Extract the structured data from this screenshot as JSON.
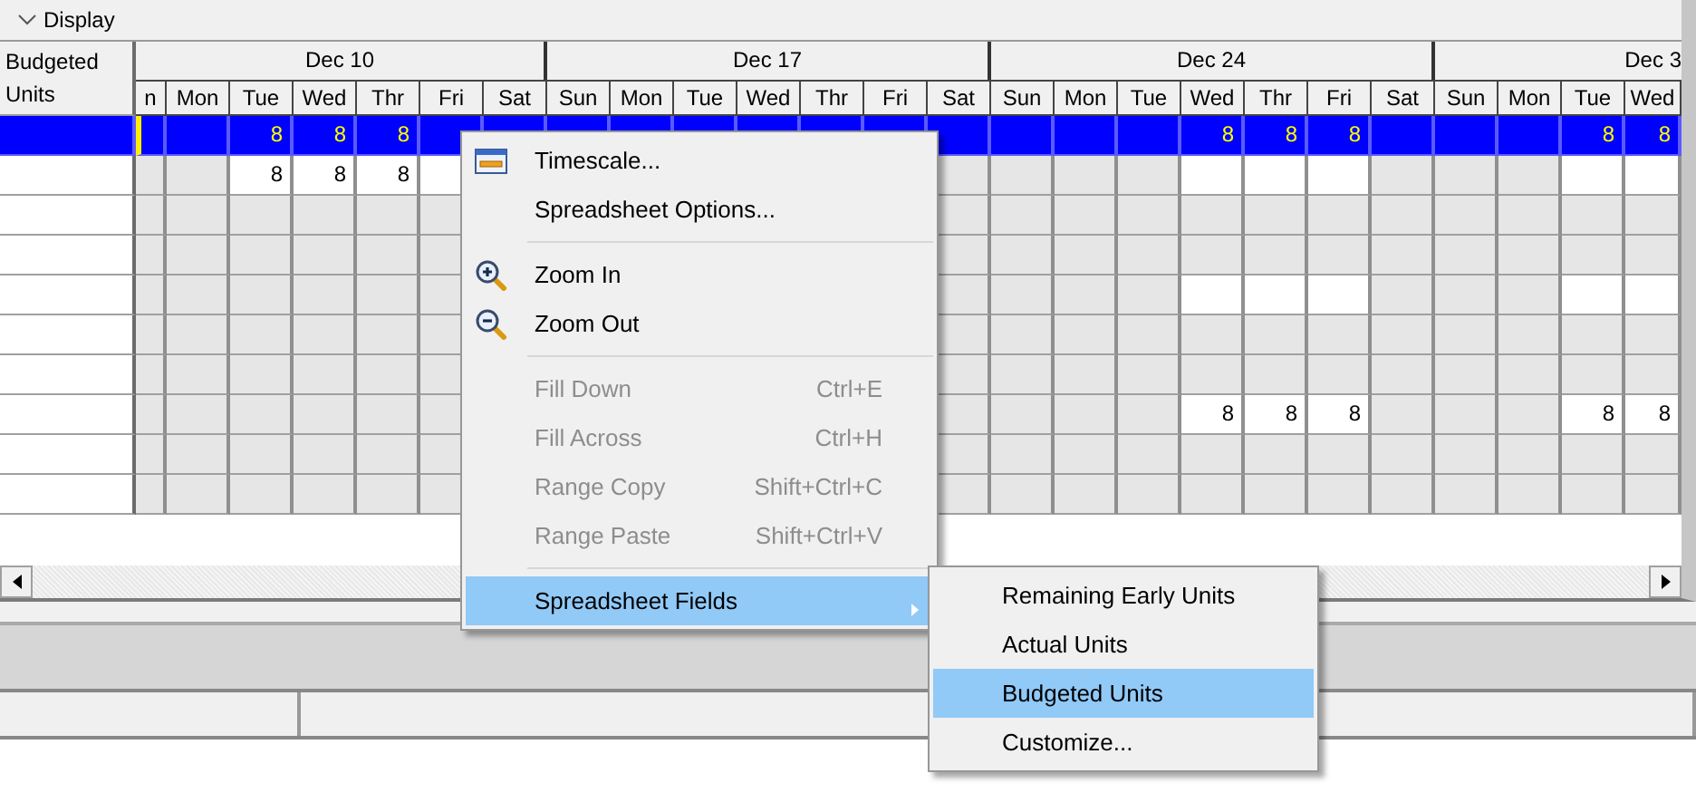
{
  "toolbar": {
    "label": "Display"
  },
  "grid": {
    "row_header": "Budgeted Units",
    "weeks": [
      {
        "label": "Dec 10",
        "days": [
          "n",
          "Mon",
          "Tue",
          "Wed",
          "Thr",
          "Fri",
          "Sat"
        ]
      },
      {
        "label": "Dec 17",
        "days": [
          "Sun",
          "Mon",
          "Tue",
          "Wed",
          "Thr",
          "Fri",
          "Sat"
        ]
      },
      {
        "label": "Dec 24",
        "days": [
          "Sun",
          "Mon",
          "Tue",
          "Wed",
          "Thr",
          "Fri",
          "Sat"
        ]
      },
      {
        "label": "Dec 3",
        "days": [
          "Sun",
          "Mon",
          "Tue",
          "Wed"
        ]
      }
    ],
    "rows": [
      {
        "selected": true,
        "cells": [
          {},
          {},
          {
            "value": "8"
          },
          {
            "value": "8"
          },
          {
            "value": "8"
          },
          {},
          {},
          {},
          {},
          {},
          {},
          {},
          {},
          {},
          {},
          {},
          {},
          {
            "value": "8"
          },
          {
            "value": "8"
          },
          {
            "value": "8"
          },
          {},
          {},
          {},
          {
            "value": "8"
          },
          {
            "value": "8"
          }
        ]
      },
      {
        "selected": false,
        "cells": [
          {
            "working": false
          },
          {
            "working": false
          },
          {
            "working": true,
            "value": "8"
          },
          {
            "working": true,
            "value": "8"
          },
          {
            "working": true,
            "value": "8"
          },
          {
            "working": true
          },
          {},
          {},
          {},
          {},
          {},
          {},
          {},
          {
            "working": false
          },
          {
            "working": false
          },
          {
            "working": false
          },
          {
            "working": false
          },
          {
            "working": true
          },
          {
            "working": true
          },
          {
            "working": true
          },
          {
            "working": false
          },
          {
            "working": false
          },
          {
            "working": false
          },
          {
            "working": true
          },
          {
            "working": true
          }
        ]
      },
      {
        "selected": false,
        "cells": [
          {
            "working": false
          },
          {
            "working": false
          },
          {
            "working": false
          },
          {
            "working": false
          },
          {
            "working": false
          },
          {
            "working": false
          },
          {},
          {},
          {},
          {},
          {},
          {},
          {},
          {
            "working": false
          },
          {
            "working": false
          },
          {
            "working": false
          },
          {
            "working": false
          },
          {
            "working": false
          },
          {
            "working": false
          },
          {
            "working": false
          },
          {
            "working": false
          },
          {
            "working": false
          },
          {
            "working": false
          },
          {
            "working": false
          },
          {
            "working": false
          }
        ]
      },
      {
        "selected": false,
        "cells": [
          {
            "working": false
          },
          {
            "working": false
          },
          {
            "working": false
          },
          {
            "working": false
          },
          {
            "working": false
          },
          {
            "working": false
          },
          {},
          {},
          {},
          {},
          {},
          {},
          {},
          {
            "working": false
          },
          {
            "working": false
          },
          {
            "working": false
          },
          {
            "working": false
          },
          {
            "working": false
          },
          {
            "working": false
          },
          {
            "working": false
          },
          {
            "working": false
          },
          {
            "working": false
          },
          {
            "working": false
          },
          {
            "working": false
          },
          {
            "working": false
          }
        ]
      },
      {
        "selected": false,
        "cells": [
          {
            "working": false
          },
          {
            "working": false
          },
          {
            "working": false
          },
          {
            "working": false
          },
          {
            "working": false
          },
          {
            "working": false
          },
          {},
          {},
          {},
          {},
          {},
          {},
          {},
          {
            "working": false
          },
          {
            "working": false
          },
          {
            "working": false
          },
          {
            "working": false
          },
          {
            "working": true
          },
          {
            "working": true
          },
          {
            "working": true
          },
          {
            "working": false
          },
          {
            "working": false
          },
          {
            "working": false
          },
          {
            "working": true
          },
          {
            "working": true
          }
        ]
      },
      {
        "selected": false,
        "cells": [
          {
            "working": false
          },
          {
            "working": false
          },
          {
            "working": false
          },
          {
            "working": false
          },
          {
            "working": false
          },
          {
            "working": false
          },
          {},
          {},
          {},
          {},
          {},
          {},
          {},
          {
            "working": false
          },
          {
            "working": false
          },
          {
            "working": false
          },
          {
            "working": false
          },
          {
            "working": false
          },
          {
            "working": false
          },
          {
            "working": false
          },
          {
            "working": false
          },
          {
            "working": false
          },
          {
            "working": false
          },
          {
            "working": false
          },
          {
            "working": false
          }
        ]
      },
      {
        "selected": false,
        "cells": [
          {
            "working": false
          },
          {
            "working": false
          },
          {
            "working": false
          },
          {
            "working": false
          },
          {
            "working": false
          },
          {
            "working": false
          },
          {},
          {},
          {},
          {},
          {},
          {},
          {},
          {
            "working": false
          },
          {
            "working": false
          },
          {
            "working": false
          },
          {
            "working": false
          },
          {
            "working": false
          },
          {
            "working": false
          },
          {
            "working": false
          },
          {
            "working": false
          },
          {
            "working": false
          },
          {
            "working": false
          },
          {
            "working": false
          },
          {
            "working": false
          }
        ]
      },
      {
        "selected": false,
        "cells": [
          {
            "working": false
          },
          {
            "working": false
          },
          {
            "working": false
          },
          {
            "working": false
          },
          {
            "working": false
          },
          {
            "working": false
          },
          {},
          {},
          {},
          {},
          {},
          {},
          {},
          {
            "working": false
          },
          {
            "working": false
          },
          {
            "working": false
          },
          {
            "working": false
          },
          {
            "working": true,
            "value": "8"
          },
          {
            "working": true,
            "value": "8"
          },
          {
            "working": true,
            "value": "8"
          },
          {
            "working": false
          },
          {
            "working": false
          },
          {
            "working": false
          },
          {
            "working": true,
            "value": "8"
          },
          {
            "working": true,
            "value": "8"
          }
        ]
      },
      {
        "selected": false,
        "cells": [
          {
            "working": false
          },
          {
            "working": false
          },
          {
            "working": false
          },
          {
            "working": false
          },
          {
            "working": false
          },
          {
            "working": false
          },
          {},
          {},
          {},
          {},
          {},
          {},
          {},
          {
            "working": false
          },
          {
            "working": false
          },
          {
            "working": false
          },
          {
            "working": false
          },
          {
            "working": false
          },
          {
            "working": false
          },
          {
            "working": false
          },
          {
            "working": false
          },
          {
            "working": false
          },
          {
            "working": false
          },
          {
            "working": false
          },
          {
            "working": false
          }
        ]
      },
      {
        "selected": false,
        "cells": [
          {
            "working": false
          },
          {
            "working": false
          },
          {
            "working": false
          },
          {
            "working": false
          },
          {
            "working": false
          },
          {
            "working": false
          },
          {},
          {},
          {},
          {},
          {},
          {},
          {},
          {
            "working": false
          },
          {
            "working": false
          },
          {
            "working": false
          },
          {
            "working": false
          },
          {
            "working": false
          },
          {
            "working": false
          },
          {
            "working": false
          },
          {
            "working": false
          },
          {
            "working": false
          },
          {
            "working": false
          },
          {
            "working": false
          },
          {
            "working": false
          }
        ]
      }
    ]
  },
  "context_menu": {
    "items": [
      {
        "kind": "item",
        "label": "Timescale...",
        "disabled": false,
        "selected": false
      },
      {
        "kind": "item",
        "label": "Spreadsheet Options...",
        "disabled": false,
        "selected": false
      },
      {
        "kind": "separator"
      },
      {
        "kind": "item",
        "label": "Zoom In",
        "disabled": false,
        "selected": false
      },
      {
        "kind": "item",
        "label": "Zoom Out",
        "disabled": false,
        "selected": false
      },
      {
        "kind": "separator"
      },
      {
        "kind": "item",
        "label": "Fill Down",
        "shortcut": "Ctrl+E",
        "disabled": true,
        "selected": false
      },
      {
        "kind": "item",
        "label": "Fill Across",
        "shortcut": "Ctrl+H",
        "disabled": true,
        "selected": false
      },
      {
        "kind": "item",
        "label": "Range Copy",
        "shortcut": "Shift+Ctrl+C",
        "disabled": true,
        "selected": false
      },
      {
        "kind": "item",
        "label": "Range Paste",
        "shortcut": "Shift+Ctrl+V",
        "disabled": true,
        "selected": false
      },
      {
        "kind": "separator"
      },
      {
        "kind": "item",
        "label": "Spreadsheet Fields",
        "submenu": true,
        "disabled": false,
        "selected": true
      }
    ]
  },
  "submenu": {
    "items": [
      {
        "kind": "item",
        "label": "Remaining Early Units",
        "disabled": false,
        "selected": false
      },
      {
        "kind": "item",
        "label": "Actual Units",
        "disabled": false,
        "selected": false
      },
      {
        "kind": "item",
        "label": "Budgeted Units",
        "disabled": false,
        "selected": true
      },
      {
        "kind": "item",
        "label": "Customize...",
        "disabled": false,
        "selected": false
      }
    ]
  }
}
